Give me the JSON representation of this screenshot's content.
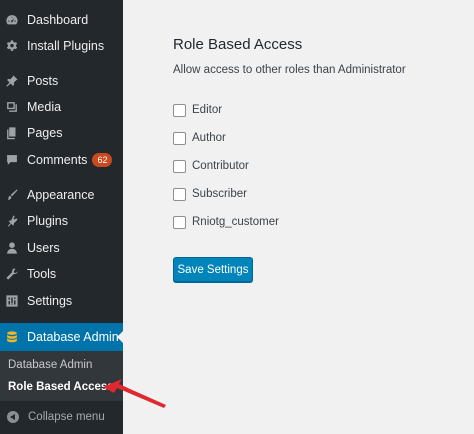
{
  "sidebar": {
    "items": [
      {
        "label": "Dashboard",
        "icon": "dashboard-icon"
      },
      {
        "label": "Install Plugins",
        "icon": "gear-icon"
      },
      {
        "label": "Posts",
        "icon": "pin-icon"
      },
      {
        "label": "Media",
        "icon": "media-icon"
      },
      {
        "label": "Pages",
        "icon": "pages-icon"
      },
      {
        "label": "Comments",
        "icon": "comment-icon",
        "badge": "62"
      },
      {
        "label": "Appearance",
        "icon": "brush-icon"
      },
      {
        "label": "Plugins",
        "icon": "plugin-icon"
      },
      {
        "label": "Users",
        "icon": "user-icon"
      },
      {
        "label": "Tools",
        "icon": "wrench-icon"
      },
      {
        "label": "Settings",
        "icon": "settings-icon"
      },
      {
        "label": "Database Admin",
        "icon": "database-icon",
        "active": true
      }
    ],
    "submenu": [
      {
        "label": "Database Admin"
      },
      {
        "label": "Role Based Access",
        "current": true
      }
    ],
    "collapse_label": "Collapse menu"
  },
  "main": {
    "title": "Role Based Access",
    "description": "Allow access to other roles than Administrator",
    "roles": [
      {
        "label": "Editor",
        "checked": false
      },
      {
        "label": "Author",
        "checked": false
      },
      {
        "label": "Contributor",
        "checked": false
      },
      {
        "label": "Subscriber",
        "checked": false
      },
      {
        "label": "Rniotg_customer",
        "checked": false
      }
    ],
    "save_label": "Save Settings"
  },
  "colors": {
    "sidebar_bg": "#23282d",
    "active_bg": "#0073aa",
    "badge_bg": "#ca4a1f",
    "button_bg": "#0085ba",
    "annotation": "#e0282f"
  }
}
